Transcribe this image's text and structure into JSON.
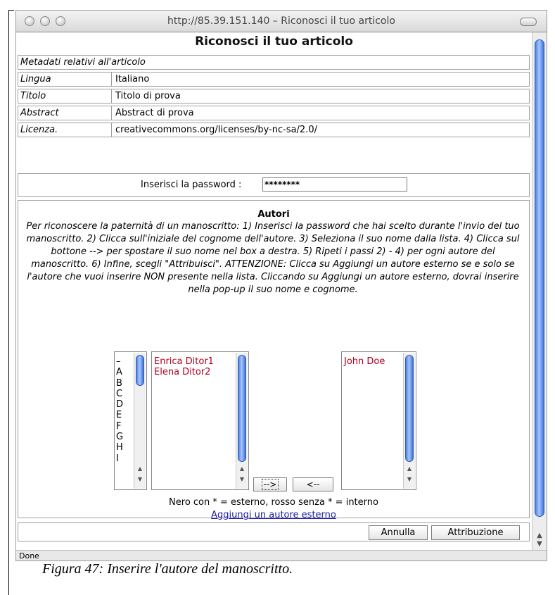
{
  "window": {
    "title": "http://85.39.151.140 – Riconosci il tuo articolo",
    "status": "Done"
  },
  "dialog": {
    "title": "Riconosci il tuo articolo",
    "metadata_header": "Metadati relativi all'articolo",
    "fields": [
      {
        "label": "Lingua",
        "value": "Italiano"
      },
      {
        "label": "Titolo",
        "value": "Titolo di prova"
      },
      {
        "label": "Abstract",
        "value": "Abstract di prova"
      },
      {
        "label": "Licenza.",
        "value": "creativecommons.org/licenses/by-nc-sa/2.0/"
      }
    ],
    "password": {
      "label": "Inserisci la password :",
      "value": "********"
    },
    "authors": {
      "title": "Autori",
      "instructions": "Per riconoscere la paternità di un manoscritto: 1) Inserisci la password che hai scelto durante l'invio del tuo manoscritto. 2) Clicca sull'iniziale del cognome dell'autore. 3) Seleziona il suo nome dalla lista. 4) Clicca sul bottone --> per spostare il suo nome nel box a destra. 5) Ripeti i passi 2) - 4) per ogni autore del manoscritto. 6) Infine, scegli \"Attribuisci\". ATTENZIONE: Clicca su Aggiungi un autore esterno se e solo se l'autore che vuoi inserire NON presente nella lista. Cliccando su Aggiungi un autore esterno, dovrai inserire nella pop-up il suo nome e cognome.",
      "letters": [
        "–",
        "A",
        "B",
        "C",
        "D",
        "E",
        "F",
        "G",
        "H",
        "I"
      ],
      "available": [
        "Enrica  Ditor1",
        "Elena  Ditor2"
      ],
      "selected": [
        "John  Doe"
      ],
      "move_right_label": "-->",
      "move_left_label": "<--",
      "legend": "Nero con * = esterno, rosso senza * = interno",
      "add_external_link": "Aggiungi un autore esterno"
    },
    "buttons": {
      "cancel": "Annulla",
      "assign": "Attribuzione"
    }
  },
  "caption": "Figura 47: Inserire l'autore del manoscritto.",
  "colors": {
    "internal_author": "#b00020",
    "link": "#1a1aa6",
    "scroll_thumb": "#4e7fdc"
  }
}
